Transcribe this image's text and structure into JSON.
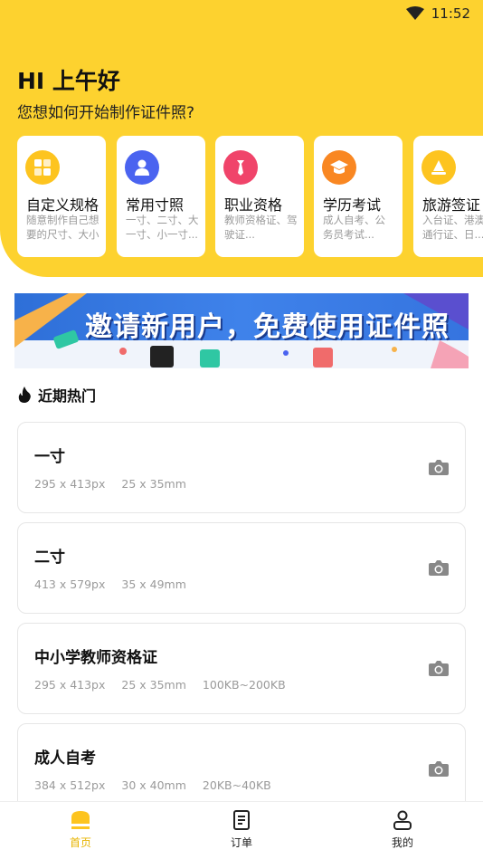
{
  "status": {
    "time": "11:52"
  },
  "header": {
    "greeting": "HI 上午好",
    "subtitle": "您想如何开始制作证件照?"
  },
  "categories": [
    {
      "title": "自定义规格",
      "desc1": "随意制作自己想",
      "desc2": "要的尺寸、大小",
      "icon": "grid-icon",
      "color": "#FDC41F"
    },
    {
      "title": "常用寸照",
      "desc1": "一寸、二寸、大",
      "desc2": "一寸、小一寸...",
      "icon": "user-icon",
      "color": "#4A63F0"
    },
    {
      "title": "职业资格",
      "desc1": "教师资格证、驾",
      "desc2": "驶证...",
      "icon": "tie-icon",
      "color": "#F0446A"
    },
    {
      "title": "学历考试",
      "desc1": "成人自考、公",
      "desc2": "务员考试...",
      "icon": "graduation-cap-icon",
      "color": "#F98722"
    },
    {
      "title": "旅游签证",
      "desc1": "入台证、港澳",
      "desc2": "通行证、日...",
      "icon": "sail-icon",
      "color": "#FDC41F"
    }
  ],
  "banner": {
    "text": "邀请新用户，免费使用证件照"
  },
  "section": {
    "title": "近期热门"
  },
  "specs": [
    {
      "title": "一寸",
      "px": "295 x 413px",
      "mm": "25 x 35mm",
      "size": ""
    },
    {
      "title": "二寸",
      "px": "413 x 579px",
      "mm": "35 x 49mm",
      "size": ""
    },
    {
      "title": "中小学教师资格证",
      "px": "295 x 413px",
      "mm": "25 x 35mm",
      "size": "100KB~200KB"
    },
    {
      "title": "成人自考",
      "px": "384 x 512px",
      "mm": "30 x 40mm",
      "size": "20KB~40KB"
    }
  ],
  "tabs": [
    {
      "label": "首页",
      "active": true
    },
    {
      "label": "订单",
      "active": false
    },
    {
      "label": "我的",
      "active": false
    }
  ],
  "colors": {
    "accent": "#FDD22F",
    "active_tab": "#E7B400"
  }
}
